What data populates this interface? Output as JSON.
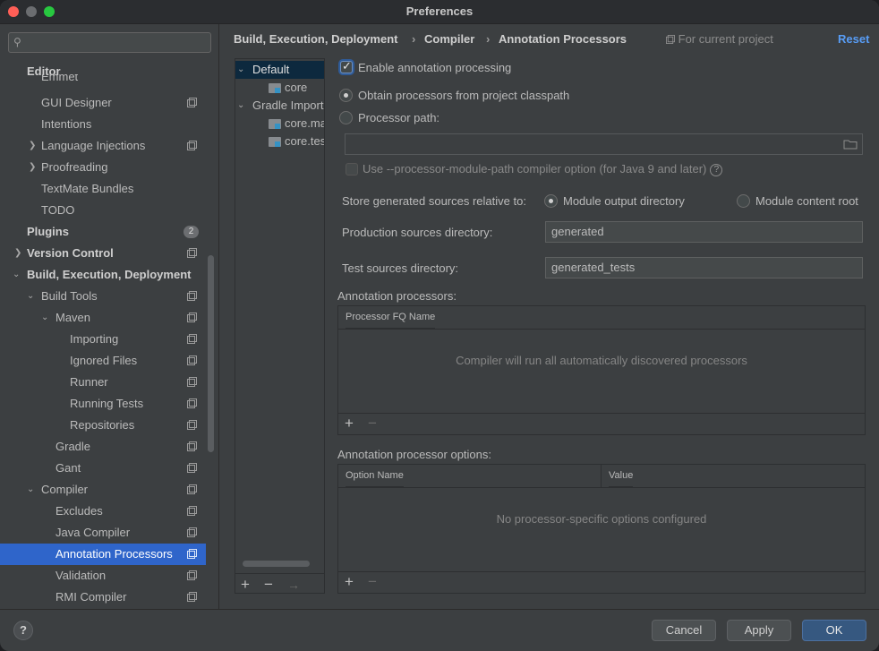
{
  "window": {
    "title": "Preferences"
  },
  "sidebar": {
    "search_placeholder": "",
    "items": [
      {
        "label": "Editor",
        "bold": true,
        "arrow": "",
        "indent": 0,
        "pin": false
      },
      {
        "label": "Emmet",
        "bold": false,
        "arrow": "",
        "indent": 1,
        "pin": false
      },
      {
        "label": "GUI Designer",
        "bold": false,
        "arrow": "",
        "indent": 1,
        "pin": true
      },
      {
        "label": "Intentions",
        "bold": false,
        "arrow": "",
        "indent": 1,
        "pin": false
      },
      {
        "label": "Language Injections",
        "bold": false,
        "arrow": ">",
        "indent": 1,
        "pin": true
      },
      {
        "label": "Proofreading",
        "bold": false,
        "arrow": ">",
        "indent": 1,
        "pin": false
      },
      {
        "label": "TextMate Bundles",
        "bold": false,
        "arrow": "",
        "indent": 1,
        "pin": false
      },
      {
        "label": "TODO",
        "bold": false,
        "arrow": "",
        "indent": 1,
        "pin": false
      },
      {
        "label": "Plugins",
        "bold": true,
        "arrow": "",
        "indent": 0,
        "pin": false,
        "badge": "2"
      },
      {
        "label": "Version Control",
        "bold": true,
        "arrow": ">",
        "indent": 0,
        "pin": true
      },
      {
        "label": "Build, Execution, Deployment",
        "bold": true,
        "arrow": "v",
        "indent": 0,
        "pin": false
      },
      {
        "label": "Build Tools",
        "bold": false,
        "arrow": "v",
        "indent": 1,
        "pin": true
      },
      {
        "label": "Maven",
        "bold": false,
        "arrow": "v",
        "indent": 2,
        "pin": true
      },
      {
        "label": "Importing",
        "bold": false,
        "arrow": "",
        "indent": 3,
        "pin": true
      },
      {
        "label": "Ignored Files",
        "bold": false,
        "arrow": "",
        "indent": 3,
        "pin": true
      },
      {
        "label": "Runner",
        "bold": false,
        "arrow": "",
        "indent": 3,
        "pin": true
      },
      {
        "label": "Running Tests",
        "bold": false,
        "arrow": "",
        "indent": 3,
        "pin": true
      },
      {
        "label": "Repositories",
        "bold": false,
        "arrow": "",
        "indent": 3,
        "pin": true
      },
      {
        "label": "Gradle",
        "bold": false,
        "arrow": "",
        "indent": 2,
        "pin": true
      },
      {
        "label": "Gant",
        "bold": false,
        "arrow": "",
        "indent": 2,
        "pin": true
      },
      {
        "label": "Compiler",
        "bold": false,
        "arrow": "v",
        "indent": 1,
        "pin": true
      },
      {
        "label": "Excludes",
        "bold": false,
        "arrow": "",
        "indent": 2,
        "pin": true
      },
      {
        "label": "Java Compiler",
        "bold": false,
        "arrow": "",
        "indent": 2,
        "pin": true
      },
      {
        "label": "Annotation Processors",
        "bold": false,
        "arrow": "",
        "indent": 2,
        "pin": true,
        "selected": true
      },
      {
        "label": "Validation",
        "bold": false,
        "arrow": "",
        "indent": 2,
        "pin": true
      },
      {
        "label": "RMI Compiler",
        "bold": false,
        "arrow": "",
        "indent": 2,
        "pin": true
      }
    ]
  },
  "breadcrumb": {
    "items": [
      "Build, Execution, Deployment",
      "Compiler",
      "Annotation Processors"
    ],
    "separator": "›",
    "scope": "For current project",
    "reset": "Reset"
  },
  "profiles": {
    "rows": [
      {
        "label": "Default",
        "arrow": "v",
        "level": 0,
        "folder": false,
        "selected": true
      },
      {
        "label": "core",
        "arrow": "",
        "level": 1,
        "folder": true
      },
      {
        "label": "Gradle Imported",
        "arrow": "v",
        "level": 0,
        "folder": false
      },
      {
        "label": "core.main",
        "arrow": "",
        "level": 1,
        "folder": true
      },
      {
        "label": "core.test",
        "arrow": "",
        "level": 1,
        "folder": true
      }
    ],
    "tools": {
      "add": "+",
      "remove": "−",
      "move": "→"
    }
  },
  "settings": {
    "enable_processing": "Enable annotation processing",
    "obtain_classpath": "Obtain processors from project classpath",
    "processor_path": "Processor path:",
    "processor_path_value": "",
    "module_path_option": "Use --processor-module-path compiler option (for Java 9 and later)",
    "store_relative_label": "Store generated sources relative to:",
    "module_output": "Module output directory",
    "module_content": "Module content root",
    "prod_label": "Production sources directory:",
    "prod_value": "generated",
    "test_label": "Test sources directory:",
    "test_value": "generated_tests"
  },
  "processors_table": {
    "title": "Annotation processors:",
    "columns": [
      "Processor FQ Name"
    ],
    "empty": "Compiler will run all automatically discovered processors",
    "add": "+",
    "remove": "−"
  },
  "options_table": {
    "title": "Annotation processor options:",
    "columns": [
      "Option Name",
      "Value"
    ],
    "empty": "No processor-specific options configured",
    "add": "+",
    "remove": "−"
  },
  "footer": {
    "help": "?",
    "cancel": "Cancel",
    "apply": "Apply",
    "ok": "OK"
  },
  "colors": {
    "accent": "#2f65ca",
    "link": "#589df6",
    "primary_button": "#365880"
  }
}
